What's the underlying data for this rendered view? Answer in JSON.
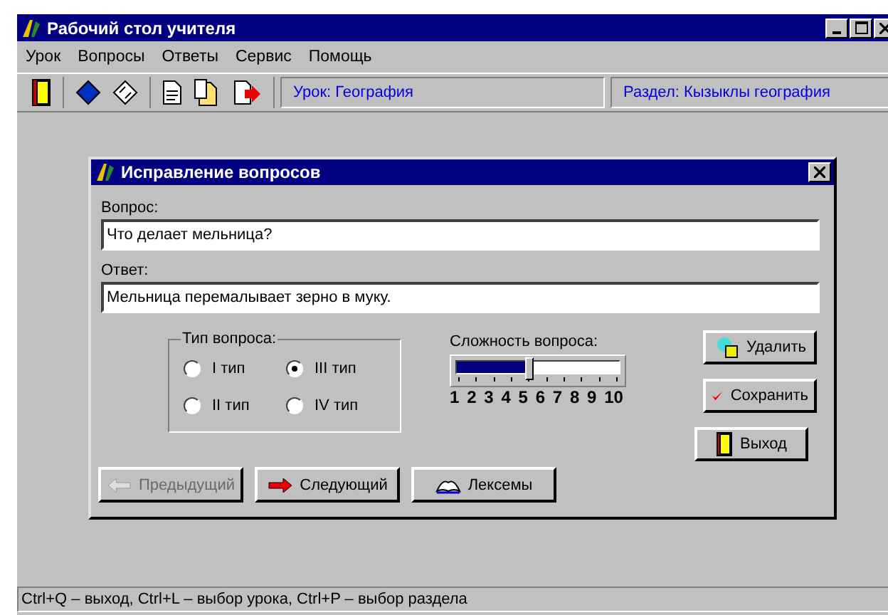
{
  "window": {
    "title": "Рабочий стол учителя"
  },
  "menu": [
    "Урок",
    "Вопросы",
    "Ответы",
    "Сервис",
    "Помощь"
  ],
  "toolbar": {
    "lesson": "Урок: География",
    "section": "Раздел: Кызыклы география"
  },
  "dialog": {
    "title": "Исправление вопросов",
    "question": {
      "label": "Вопрос:",
      "value": "Что делает мельница?"
    },
    "answer": {
      "label": "Ответ:",
      "value": "Мельница перемалывает зерно в муку."
    },
    "type_group": {
      "title": "Тип вопроса:",
      "options": [
        {
          "label": "I тип",
          "selected": false
        },
        {
          "label": "III тип",
          "selected": true
        },
        {
          "label": "II тип",
          "selected": false
        },
        {
          "label": "IV тип",
          "selected": false
        }
      ]
    },
    "difficulty": {
      "label": "Сложность вопроса:",
      "level": 0.44,
      "scale": [
        "1",
        "2",
        "3",
        "4",
        "5",
        "6",
        "7",
        "8",
        "9",
        "10"
      ]
    },
    "side_buttons": [
      {
        "kind": "delete",
        "label": "Удалить"
      },
      {
        "kind": "save",
        "label": "Сохранить"
      },
      {
        "kind": "exit",
        "label": "Выход"
      }
    ],
    "nav_buttons": [
      {
        "kind": "prev",
        "label": "Предыдущий",
        "disabled": true
      },
      {
        "kind": "next",
        "label": "Следующий",
        "disabled": false
      },
      {
        "kind": "lexemes",
        "label": "Лексемы",
        "disabled": false
      }
    ]
  },
  "status_bar": "Ctrl+Q – выход, Ctrl+L – выбор урока, Ctrl+P – выбор раздела"
}
